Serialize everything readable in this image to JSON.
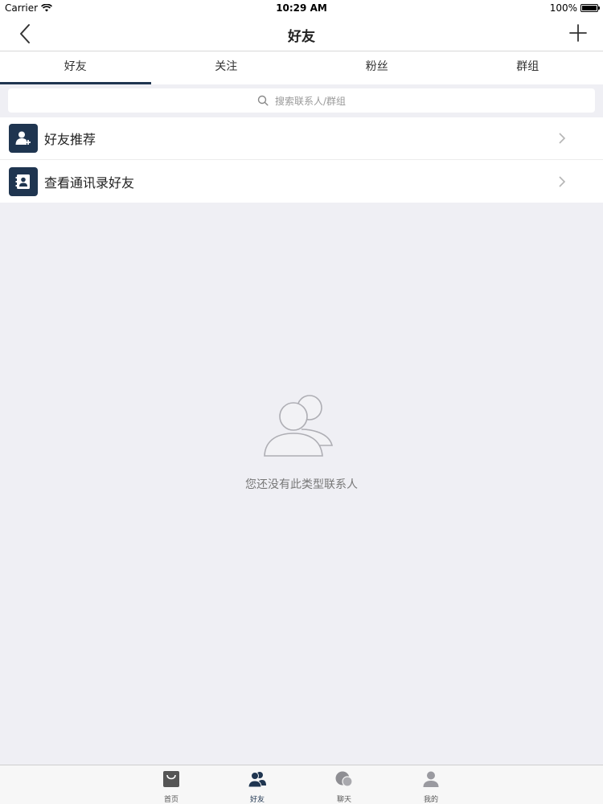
{
  "status_bar": {
    "carrier": "Carrier",
    "time": "10:29 AM",
    "battery": "100%"
  },
  "nav": {
    "title": "好友"
  },
  "tabs": [
    {
      "label": "好友",
      "active": true
    },
    {
      "label": "关注",
      "active": false
    },
    {
      "label": "粉丝",
      "active": false
    },
    {
      "label": "群组",
      "active": false
    }
  ],
  "search": {
    "placeholder": "搜索联系人/群组"
  },
  "list": [
    {
      "label": "好友推荐",
      "icon": "add-user-icon"
    },
    {
      "label": "查看通讯录好友",
      "icon": "contacts-book-icon"
    }
  ],
  "empty_state": {
    "message": "您还没有此类型联系人",
    "icon": "contacts-empty-icon"
  },
  "tabbar": [
    {
      "label": "首页",
      "icon": "shopping-bag-icon",
      "active": false
    },
    {
      "label": "好友",
      "icon": "friends-icon",
      "active": true
    },
    {
      "label": "聊天",
      "icon": "chat-icon",
      "active": false
    },
    {
      "label": "我的",
      "icon": "person-icon",
      "active": false
    }
  ],
  "colors": {
    "accent": "#1f3550",
    "background": "#efeff4"
  }
}
